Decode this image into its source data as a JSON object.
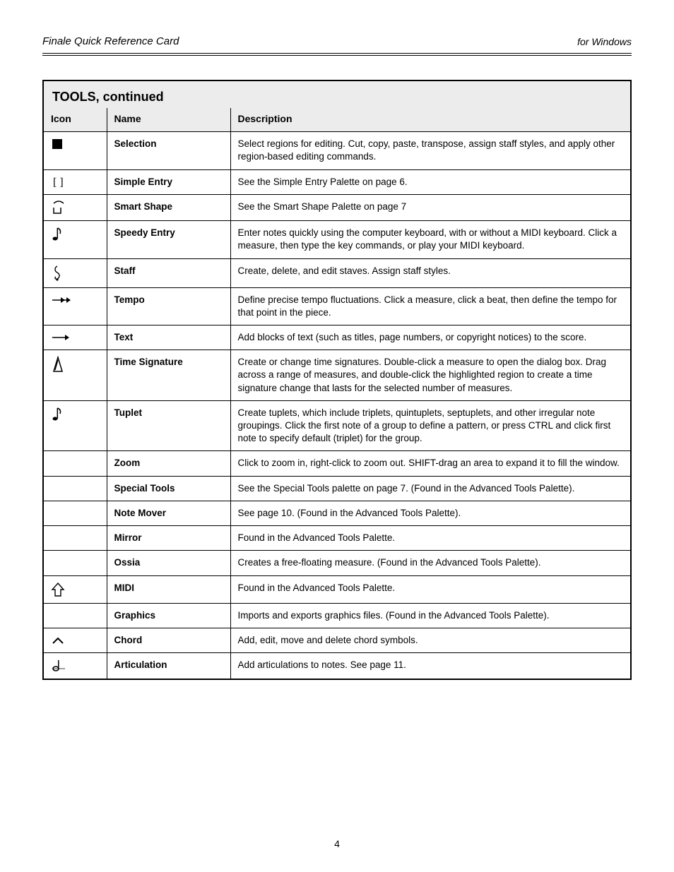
{
  "header": {
    "left": "Finale Quick Reference Card",
    "right": "for Windows"
  },
  "table": {
    "title": "TOOLS, continued",
    "col_icon": "Icon",
    "col_name": "Name",
    "col_desc": "Description"
  },
  "rows": [
    {
      "icon": "selection",
      "name": "Selection",
      "desc": "Select regions for editing. Cut, copy, paste, transpose, assign staff styles, and apply other region-based editing commands."
    },
    {
      "icon": "bracket",
      "name": "Simple Entry",
      "desc": "See the Simple Entry Palette on page 6."
    },
    {
      "icon": "slur",
      "name": "Smart Shape",
      "desc": "See the Smart Shape Palette on page 7"
    },
    {
      "icon": "eighth-note",
      "name": "Speedy Entry",
      "desc": "Enter notes quickly using the computer keyboard, with or without a MIDI keyboard. Click a measure, then type the key commands, or play your MIDI keyboard."
    },
    {
      "icon": "treble",
      "name": "Staff",
      "desc": "Create, delete, and edit staves. Assign staff styles."
    },
    {
      "icon": "double-arrow",
      "name": "Tempo",
      "desc": "Define precise tempo fluctuations. Click a measure, click a beat, then define the tempo for that point in the piece."
    },
    {
      "icon": "single-arrow",
      "name": "Text",
      "desc": "Add blocks of text (such as titles, page numbers, or copyright notices) to the score."
    },
    {
      "icon": "metronome",
      "name": "Time Signature",
      "desc": "Create or change time signatures. Double-click a measure to open the dialog box. Drag across a range of measures, and double-click the highlighted region to create a time signature change that lasts for the selected number of measures."
    },
    {
      "icon": "eighth-note",
      "name": "Tuplet",
      "desc": "Create tuplets, which include triplets, quintuplets, septuplets, and other irregular note groupings. Click the first note of a group to define a pattern, or press CTRL and click first note to specify default (triplet) for the group."
    },
    {
      "icon": "",
      "name": "Zoom",
      "desc": "Click to zoom in, right-click to zoom out. SHIFT-drag an area to expand it to fill the window."
    },
    {
      "icon": "",
      "name": "Special Tools",
      "desc": "See the Special Tools palette on page 7. (Found in the Advanced Tools Palette)."
    },
    {
      "icon": "",
      "name": "Note Mover",
      "desc": "See page 10. (Found in the Advanced Tools Palette)."
    },
    {
      "icon": "",
      "name": "Mirror",
      "desc": "Found in the Advanced Tools Palette."
    },
    {
      "icon": "",
      "name": "Ossia",
      "desc": "Creates a free-floating measure. (Found in the Advanced Tools Palette)."
    },
    {
      "icon": "shift-arrow",
      "name": "MIDI",
      "desc": "Found in the Advanced Tools Palette."
    },
    {
      "icon": "",
      "name": "Graphics",
      "desc": "Imports and exports graphics files. (Found in the Advanced Tools Palette)."
    },
    {
      "icon": "caret",
      "name": "Chord",
      "desc": "Add, edit, move and delete chord symbols."
    },
    {
      "icon": "half-note",
      "name": "Articulation",
      "desc": "Add articulations to notes. See page 11."
    }
  ],
  "footer": "4"
}
